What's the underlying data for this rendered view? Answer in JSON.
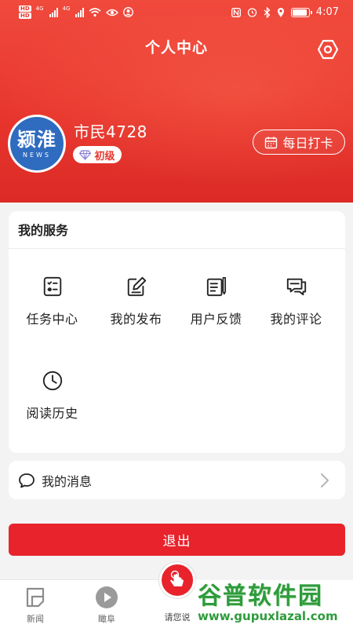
{
  "status_bar": {
    "time": "4:07",
    "hd_labels": [
      "HD",
      "HD"
    ],
    "signal_labels": [
      "4G",
      "4G"
    ],
    "battery_percent": 90
  },
  "header": {
    "title": "个人中心",
    "background_color": "#e8362e"
  },
  "profile": {
    "avatar_text": "颍淮",
    "avatar_subtext": "NEWS",
    "username": "市民4728",
    "level": "初级",
    "checkin_label": "每日打卡"
  },
  "services": {
    "title": "我的服务",
    "items": [
      {
        "label": "任务中心",
        "icon": "task-list-icon"
      },
      {
        "label": "我的发布",
        "icon": "edit-note-icon"
      },
      {
        "label": "用户反馈",
        "icon": "feedback-doc-icon"
      },
      {
        "label": "我的评论",
        "icon": "comment-icon"
      },
      {
        "label": "阅读历史",
        "icon": "clock-icon"
      }
    ]
  },
  "messages": {
    "label": "我的消息"
  },
  "logout": {
    "label": "退出",
    "color": "#e8232c"
  },
  "tabbar": {
    "items": [
      {
        "label": "新闻",
        "icon": "news-icon"
      },
      {
        "label": "瞰阜",
        "icon": "play-icon"
      },
      {
        "label": "请您说",
        "icon": "hand-tap-icon"
      }
    ]
  },
  "watermark": {
    "text": "谷普软件园",
    "url": "www.gupuxlazal.com"
  }
}
